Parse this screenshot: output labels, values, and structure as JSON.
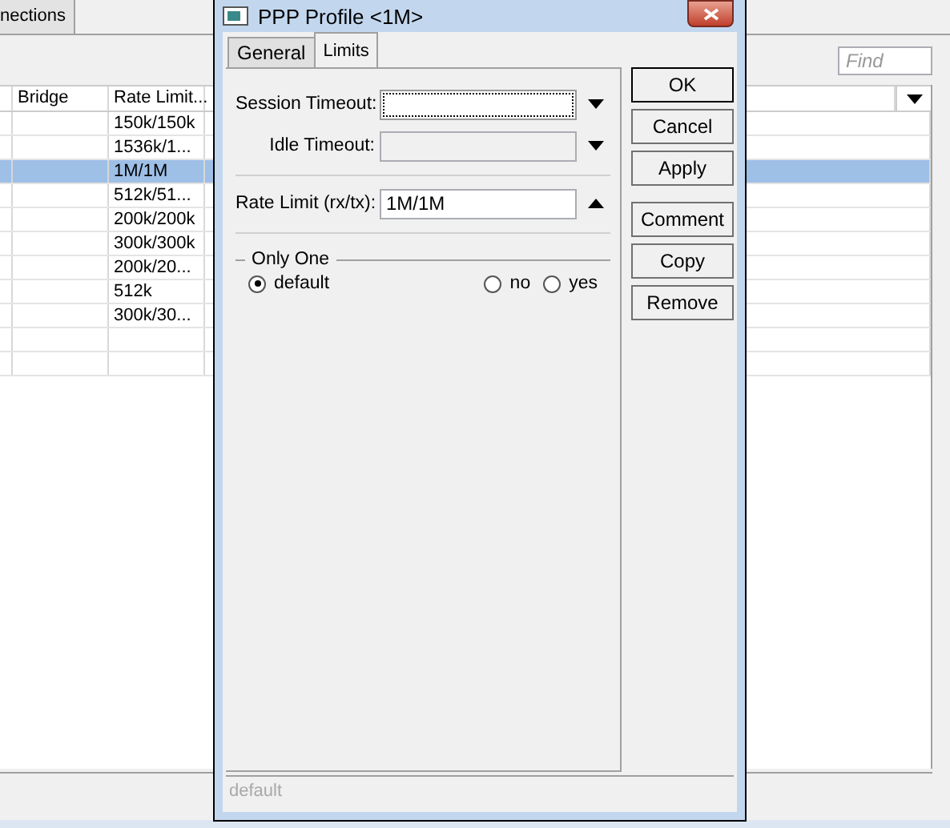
{
  "background_window": {
    "tab": "nections",
    "search": {
      "placeholder": "Find"
    },
    "table": {
      "columns": [
        "Bridge",
        "Rate Limit..."
      ],
      "rows": [
        {
          "rate_limit": "150k/150k",
          "selected": false
        },
        {
          "rate_limit": "1536k/1...",
          "selected": false
        },
        {
          "rate_limit": "1M/1M",
          "selected": true
        },
        {
          "rate_limit": "512k/51...",
          "selected": false
        },
        {
          "rate_limit": "200k/200k",
          "selected": false
        },
        {
          "rate_limit": "300k/300k",
          "selected": false
        },
        {
          "rate_limit": "200k/20...",
          "selected": false
        },
        {
          "rate_limit": "512k",
          "selected": false
        },
        {
          "rate_limit": "300k/30...",
          "selected": false
        }
      ]
    }
  },
  "dialog": {
    "title": "PPP Profile <1M>",
    "tabs": [
      {
        "label": "General",
        "selected": false
      },
      {
        "label": "Limits",
        "selected": true
      }
    ],
    "field_sections": [
      [
        {
          "label": "Session Timeout:",
          "focused": true,
          "disabled": false,
          "kind": "dropdown"
        },
        {
          "label": "Idle Timeout:",
          "focused": false,
          "disabled": true,
          "kind": "dropdown"
        }
      ],
      [
        {
          "label": "Rate Limit (rx/tx):",
          "value": "1M/1M",
          "focused": false,
          "disabled": false,
          "kind": "collapse"
        }
      ]
    ],
    "only_one": {
      "title": "Only One",
      "options": [
        {
          "label": "default",
          "selected": true
        },
        {
          "label": "no",
          "selected": false
        },
        {
          "label": "yes",
          "selected": false
        }
      ]
    },
    "button_groups": [
      [
        {
          "label": "OK",
          "default": true
        },
        {
          "label": "Cancel",
          "default": false
        },
        {
          "label": "Apply",
          "default": false
        }
      ],
      [
        {
          "label": "Comment",
          "default": false
        },
        {
          "label": "Copy",
          "default": false
        },
        {
          "label": "Remove",
          "default": false
        }
      ]
    ],
    "status": "default"
  }
}
